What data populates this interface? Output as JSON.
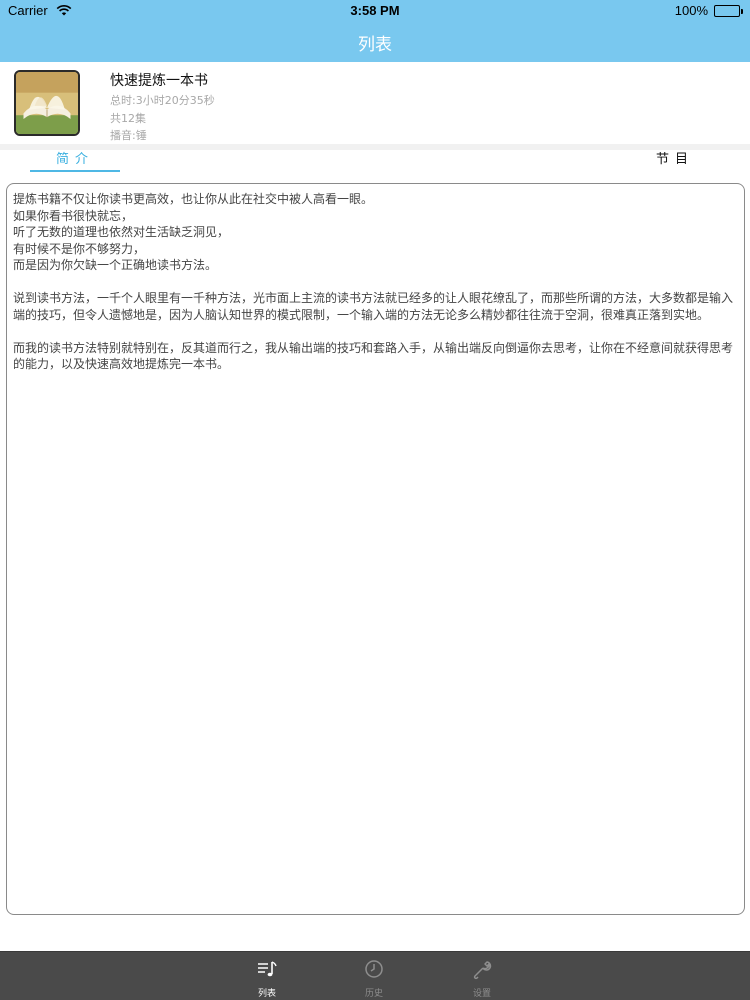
{
  "status_bar": {
    "carrier": "Carrier",
    "time": "3:58 PM",
    "battery": "100%"
  },
  "nav": {
    "title": "列表"
  },
  "book": {
    "title": "快速提炼一本书",
    "duration": "总时:3小时20分35秒",
    "episodes": "共12集",
    "narrator": "播音:锤"
  },
  "tabs": {
    "intro": "简介",
    "episodes": "节目"
  },
  "description": [
    "提炼书籍不仅让你读书更高效，也让你从此在社交中被人高看一眼。",
    "如果你看书很快就忘，",
    "听了无数的道理也依然对生活缺乏洞见，",
    "有时候不是你不够努力，",
    "而是因为你欠缺一个正确地读书方法。",
    "",
    "说到读书方法，一千个人眼里有一千种方法，光市面上主流的读书方法就已经多的让人眼花缭乱了，而那些所谓的方法，大多数都是输入端的技巧，但令人遗憾地是，因为人脑认知世界的模式限制，一个输入端的方法无论多么精妙都往往流于空洞，很难真正落到实地。",
    "",
    "而我的读书方法特别就特别在，反其道而行之，我从输出端的技巧和套路入手，从输出端反向倒逼你去思考，让你在不经意间就获得思考的能力，以及快速高效地提炼完一本书。"
  ],
  "tabbar": [
    {
      "label": "列表",
      "icon": "music-list-icon",
      "active": true
    },
    {
      "label": "历史",
      "icon": "clock-icon",
      "active": false
    },
    {
      "label": "设置",
      "icon": "wrench-icon",
      "active": false
    }
  ],
  "colors": {
    "nav_bg": "#79c8ef",
    "accent": "#3bb0e0",
    "tabbar_bg": "#4a4a4a"
  }
}
